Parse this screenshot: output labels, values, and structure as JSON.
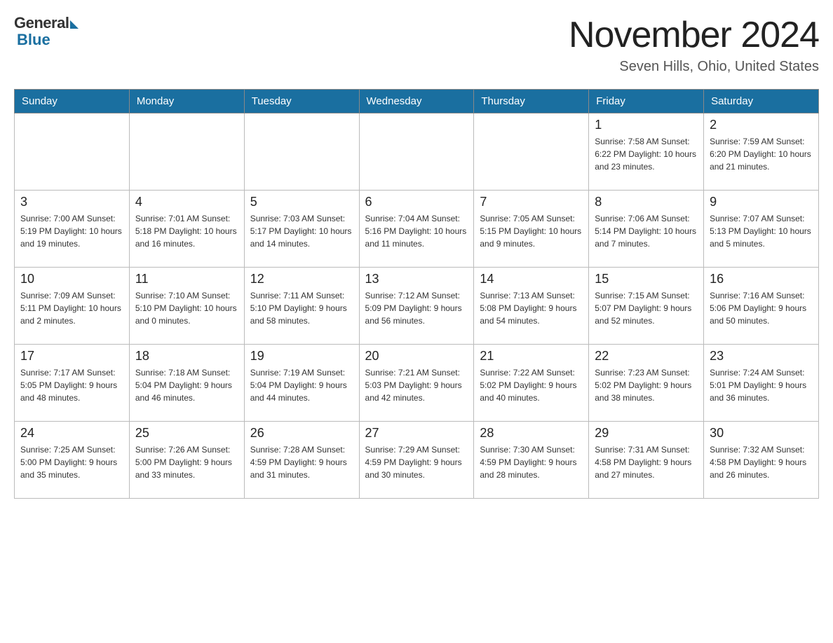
{
  "header": {
    "logo_general": "General",
    "logo_blue": "Blue",
    "month_title": "November 2024",
    "location": "Seven Hills, Ohio, United States"
  },
  "weekdays": [
    "Sunday",
    "Monday",
    "Tuesday",
    "Wednesday",
    "Thursday",
    "Friday",
    "Saturday"
  ],
  "weeks": [
    [
      {
        "day": "",
        "info": ""
      },
      {
        "day": "",
        "info": ""
      },
      {
        "day": "",
        "info": ""
      },
      {
        "day": "",
        "info": ""
      },
      {
        "day": "",
        "info": ""
      },
      {
        "day": "1",
        "info": "Sunrise: 7:58 AM\nSunset: 6:22 PM\nDaylight: 10 hours\nand 23 minutes."
      },
      {
        "day": "2",
        "info": "Sunrise: 7:59 AM\nSunset: 6:20 PM\nDaylight: 10 hours\nand 21 minutes."
      }
    ],
    [
      {
        "day": "3",
        "info": "Sunrise: 7:00 AM\nSunset: 5:19 PM\nDaylight: 10 hours\nand 19 minutes."
      },
      {
        "day": "4",
        "info": "Sunrise: 7:01 AM\nSunset: 5:18 PM\nDaylight: 10 hours\nand 16 minutes."
      },
      {
        "day": "5",
        "info": "Sunrise: 7:03 AM\nSunset: 5:17 PM\nDaylight: 10 hours\nand 14 minutes."
      },
      {
        "day": "6",
        "info": "Sunrise: 7:04 AM\nSunset: 5:16 PM\nDaylight: 10 hours\nand 11 minutes."
      },
      {
        "day": "7",
        "info": "Sunrise: 7:05 AM\nSunset: 5:15 PM\nDaylight: 10 hours\nand 9 minutes."
      },
      {
        "day": "8",
        "info": "Sunrise: 7:06 AM\nSunset: 5:14 PM\nDaylight: 10 hours\nand 7 minutes."
      },
      {
        "day": "9",
        "info": "Sunrise: 7:07 AM\nSunset: 5:13 PM\nDaylight: 10 hours\nand 5 minutes."
      }
    ],
    [
      {
        "day": "10",
        "info": "Sunrise: 7:09 AM\nSunset: 5:11 PM\nDaylight: 10 hours\nand 2 minutes."
      },
      {
        "day": "11",
        "info": "Sunrise: 7:10 AM\nSunset: 5:10 PM\nDaylight: 10 hours\nand 0 minutes."
      },
      {
        "day": "12",
        "info": "Sunrise: 7:11 AM\nSunset: 5:10 PM\nDaylight: 9 hours\nand 58 minutes."
      },
      {
        "day": "13",
        "info": "Sunrise: 7:12 AM\nSunset: 5:09 PM\nDaylight: 9 hours\nand 56 minutes."
      },
      {
        "day": "14",
        "info": "Sunrise: 7:13 AM\nSunset: 5:08 PM\nDaylight: 9 hours\nand 54 minutes."
      },
      {
        "day": "15",
        "info": "Sunrise: 7:15 AM\nSunset: 5:07 PM\nDaylight: 9 hours\nand 52 minutes."
      },
      {
        "day": "16",
        "info": "Sunrise: 7:16 AM\nSunset: 5:06 PM\nDaylight: 9 hours\nand 50 minutes."
      }
    ],
    [
      {
        "day": "17",
        "info": "Sunrise: 7:17 AM\nSunset: 5:05 PM\nDaylight: 9 hours\nand 48 minutes."
      },
      {
        "day": "18",
        "info": "Sunrise: 7:18 AM\nSunset: 5:04 PM\nDaylight: 9 hours\nand 46 minutes."
      },
      {
        "day": "19",
        "info": "Sunrise: 7:19 AM\nSunset: 5:04 PM\nDaylight: 9 hours\nand 44 minutes."
      },
      {
        "day": "20",
        "info": "Sunrise: 7:21 AM\nSunset: 5:03 PM\nDaylight: 9 hours\nand 42 minutes."
      },
      {
        "day": "21",
        "info": "Sunrise: 7:22 AM\nSunset: 5:02 PM\nDaylight: 9 hours\nand 40 minutes."
      },
      {
        "day": "22",
        "info": "Sunrise: 7:23 AM\nSunset: 5:02 PM\nDaylight: 9 hours\nand 38 minutes."
      },
      {
        "day": "23",
        "info": "Sunrise: 7:24 AM\nSunset: 5:01 PM\nDaylight: 9 hours\nand 36 minutes."
      }
    ],
    [
      {
        "day": "24",
        "info": "Sunrise: 7:25 AM\nSunset: 5:00 PM\nDaylight: 9 hours\nand 35 minutes."
      },
      {
        "day": "25",
        "info": "Sunrise: 7:26 AM\nSunset: 5:00 PM\nDaylight: 9 hours\nand 33 minutes."
      },
      {
        "day": "26",
        "info": "Sunrise: 7:28 AM\nSunset: 4:59 PM\nDaylight: 9 hours\nand 31 minutes."
      },
      {
        "day": "27",
        "info": "Sunrise: 7:29 AM\nSunset: 4:59 PM\nDaylight: 9 hours\nand 30 minutes."
      },
      {
        "day": "28",
        "info": "Sunrise: 7:30 AM\nSunset: 4:59 PM\nDaylight: 9 hours\nand 28 minutes."
      },
      {
        "day": "29",
        "info": "Sunrise: 7:31 AM\nSunset: 4:58 PM\nDaylight: 9 hours\nand 27 minutes."
      },
      {
        "day": "30",
        "info": "Sunrise: 7:32 AM\nSunset: 4:58 PM\nDaylight: 9 hours\nand 26 minutes."
      }
    ]
  ]
}
